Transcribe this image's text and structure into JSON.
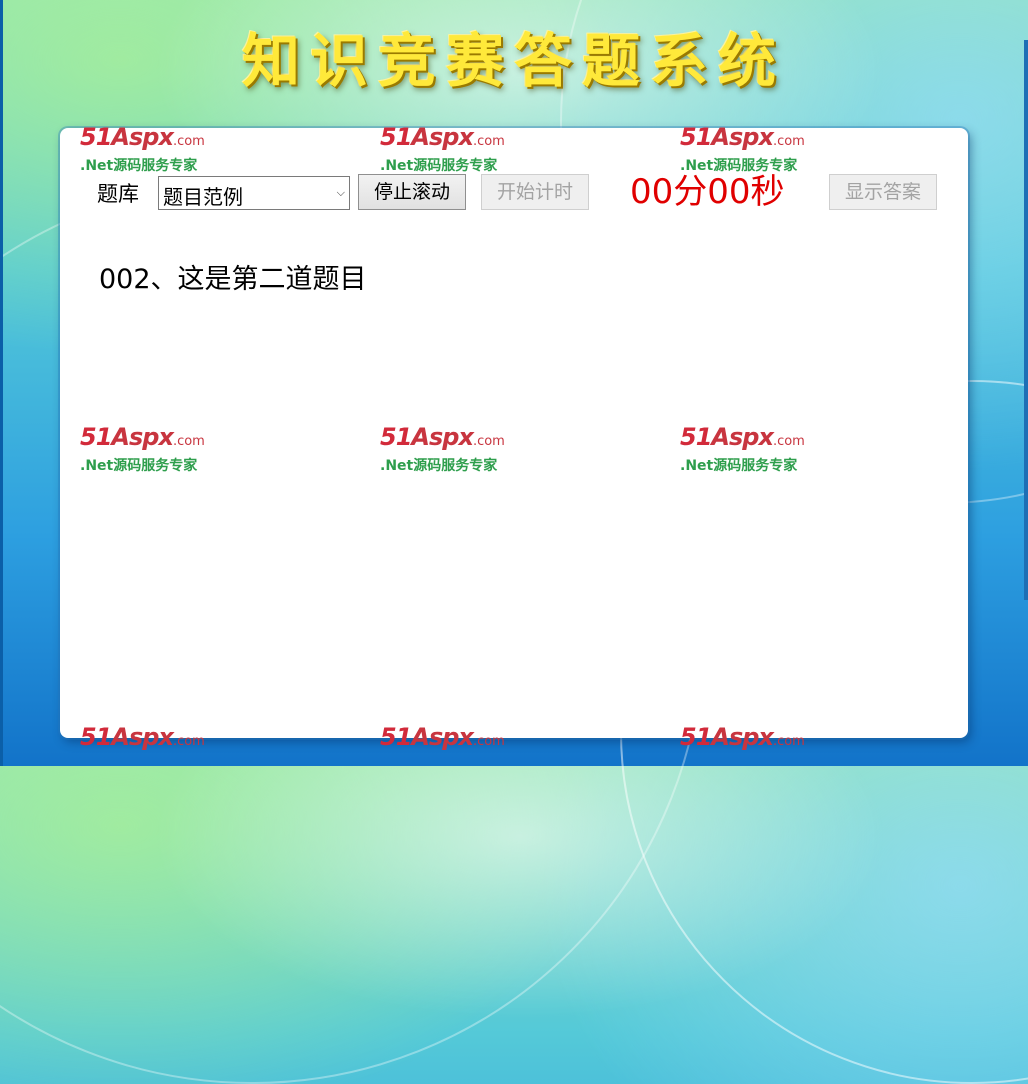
{
  "title": "知识竞赛答题系统",
  "toolbar": {
    "bank_label": "题库",
    "bank_selected": "题目范例",
    "stop_scroll_label": "停止滚动",
    "start_timer_label": "开始计时",
    "timer": "00分00秒",
    "show_answer_label": "显示答案"
  },
  "question": {
    "text": "002、这是第二道题目"
  },
  "watermark": {
    "brand_num": "51",
    "brand_name": "Aspx",
    "brand_suffix": ".com",
    "tagline": ".Net源码服务专家"
  },
  "colors": {
    "title": "#ffe93a",
    "timer": "#e00000",
    "panel": "#ffffff"
  }
}
